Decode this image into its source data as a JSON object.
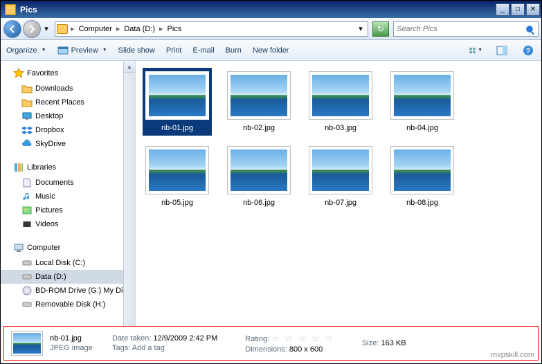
{
  "title": "Pics",
  "breadcrumb": [
    "Computer",
    "Data (D:)",
    "Pics"
  ],
  "search_placeholder": "Search Pics",
  "commands": {
    "organize": "Organize",
    "preview": "Preview",
    "slideshow": "Slide show",
    "print": "Print",
    "email": "E-mail",
    "burn": "Burn",
    "newfolder": "New folder"
  },
  "sidebar": {
    "favorites": {
      "label": "Favorites",
      "items": [
        "Downloads",
        "Recent Places",
        "Desktop",
        "Dropbox",
        "SkyDrive"
      ]
    },
    "libraries": {
      "label": "Libraries",
      "items": [
        "Documents",
        "Music",
        "Pictures",
        "Videos"
      ]
    },
    "computer": {
      "label": "Computer",
      "items": [
        "Local Disk (C:)",
        "Data (D:)",
        "BD-ROM Drive (G:) My Dis",
        "Removable Disk (H:)"
      ]
    }
  },
  "files": [
    {
      "name": "nb-01.jpg",
      "selected": true
    },
    {
      "name": "nb-02.jpg",
      "selected": false
    },
    {
      "name": "nb-03.jpg",
      "selected": false
    },
    {
      "name": "nb-04.jpg",
      "selected": false
    },
    {
      "name": "nb-05.jpg",
      "selected": false
    },
    {
      "name": "nb-06.jpg",
      "selected": false
    },
    {
      "name": "nb-07.jpg",
      "selected": false
    },
    {
      "name": "nb-08.jpg",
      "selected": false
    }
  ],
  "details": {
    "name": "nb-01.jpg",
    "type": "JPEG image",
    "date_label": "Date taken:",
    "date": "12/9/2009 2:42 PM",
    "tags_label": "Tags:",
    "tags": "Add a tag",
    "rating_label": "Rating:",
    "dims_label": "Dimensions:",
    "dims": "800 x 600",
    "size_label": "Size:",
    "size": "163 KB"
  },
  "watermark": "mvpskill.com"
}
